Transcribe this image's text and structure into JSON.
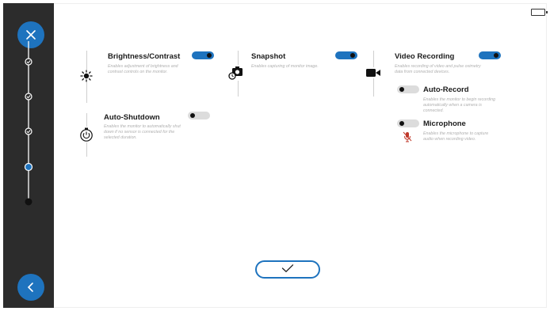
{
  "sidebar": {
    "close_icon": "close-icon",
    "back_icon": "chevron-left-icon",
    "steps": [
      {
        "state": "done"
      },
      {
        "state": "done"
      },
      {
        "state": "done"
      },
      {
        "state": "current"
      },
      {
        "state": "pending"
      }
    ]
  },
  "settings": {
    "brightness": {
      "title": "Brightness/Contrast",
      "description": "Enables adjustment of brightness and contrast controls on the monitor.",
      "enabled": true,
      "icon": "sun-icon"
    },
    "snapshot": {
      "title": "Snapshot",
      "description": "Enables capturing of monitor image.",
      "enabled": true,
      "icon": "camera-timer-icon"
    },
    "video_recording": {
      "title": "Video Recording",
      "description": "Enables recording of video and pulse oximetry data from connected devices.",
      "enabled": true,
      "icon": "video-camera-icon"
    },
    "auto_record": {
      "title": "Auto-Record",
      "description": "Enables the monitor to begin recording automatically when a camera is connected.",
      "enabled": false
    },
    "microphone": {
      "title": "Microphone",
      "description": "Enables the microphone to capture audio when recording video.",
      "enabled": false,
      "icon": "microphone-off-icon"
    },
    "auto_shutdown": {
      "title": "Auto-Shutdown",
      "description": "Enables the monitor to automatically shut down if no sensor is connected for the selected duration.",
      "enabled": false,
      "icon": "power-icon"
    }
  },
  "confirm": {
    "icon": "checkmark-icon"
  },
  "status": {
    "battery_icon": "battery-icon"
  },
  "colors": {
    "accent": "#1e73be",
    "sidebar": "#2c2c2c"
  }
}
